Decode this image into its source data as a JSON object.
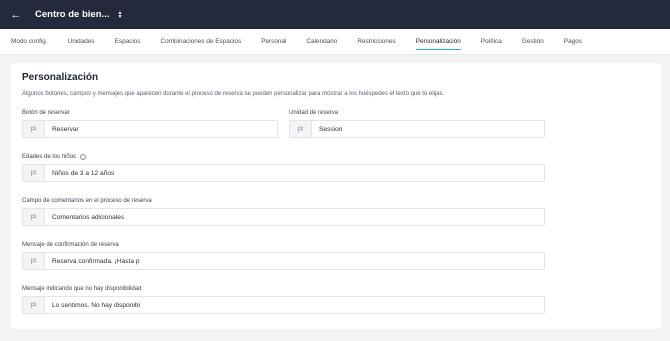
{
  "topbar": {
    "venue_name": "Centro de bien..."
  },
  "tabs": [
    {
      "label": "Modo config."
    },
    {
      "label": "Unidades"
    },
    {
      "label": "Espacios"
    },
    {
      "label": "Combinaciones de Espacios"
    },
    {
      "label": "Personal"
    },
    {
      "label": "Calendario"
    },
    {
      "label": "Restricciones"
    },
    {
      "label": "Personalización",
      "active": true
    },
    {
      "label": "Política"
    },
    {
      "label": "Gestión"
    },
    {
      "label": "Pagos"
    }
  ],
  "section": {
    "title": "Personalización",
    "description": "Algunos botones, campos y mensajes que aparecen durante el proceso de reserva se pueden personalizar para mostrar a los huéspedes el texto que tú elijas."
  },
  "fields": {
    "book_button": {
      "label": "Botón de reservar",
      "value": "Reservar"
    },
    "booking_unit": {
      "label": "Unidad de reserva",
      "value": "Session"
    },
    "children_ages": {
      "label": "Edades de los niños",
      "value": "Niños de 3 a 12 años"
    },
    "comments": {
      "label": "Campo de comentarios en el proceso de reserva",
      "value": "Comentarios adicionales"
    },
    "confirmation": {
      "label": "Mensaje de confirmación de reserva",
      "value": "Reserva confirmada. ¡Hasta pronto!"
    },
    "unavailable": {
      "label": "Mensaje indicando que no hay disponibilidad",
      "value": "Lo sentimos. No hay disponibilidad."
    }
  }
}
